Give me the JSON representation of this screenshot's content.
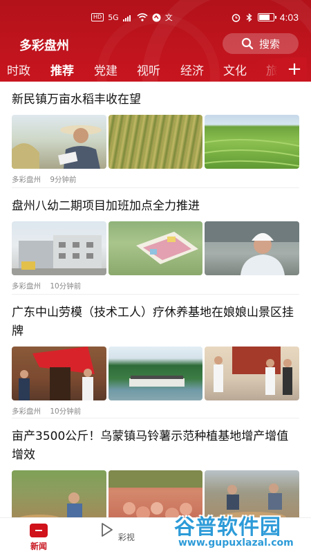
{
  "status_bar": {
    "left_text": "HD",
    "signal_text": "5G",
    "extra_icon_text": "文",
    "time": "4:03",
    "battery_level": 0.85
  },
  "header": {
    "app_title": "多彩盘州",
    "search_label": "搜索"
  },
  "tabs": [
    {
      "label": "时政"
    },
    {
      "label": "推荐"
    },
    {
      "label": "党建"
    },
    {
      "label": "视听"
    },
    {
      "label": "经济"
    },
    {
      "label": "文化"
    },
    {
      "label": "旅"
    }
  ],
  "active_tab": "推荐",
  "articles": [
    {
      "title": "新民镇万亩水稻丰收在望",
      "source": "多彩盘州",
      "time": "9分钟前"
    },
    {
      "title": "盘州八幼二期项目加班加点全力推进",
      "source": "多彩盘州",
      "time": "10分钟前"
    },
    {
      "title": "广东中山劳模（技术工人）疗休养基地在娘娘山景区挂牌",
      "source": "多彩盘州",
      "time": "10分钟前"
    },
    {
      "title": "亩产3500公斤！乌蒙镇马铃薯示范种植基地增产增值增效",
      "source": "",
      "time": ""
    }
  ],
  "bottom_nav": [
    {
      "label": "新闻"
    },
    {
      "label": "彩视"
    }
  ],
  "watermark": {
    "main": "谷普软件园",
    "url": "www.gupuxlazal.com"
  },
  "colors": {
    "brand_red": "#c8151f",
    "watermark_blue": "#2d9bd8"
  }
}
